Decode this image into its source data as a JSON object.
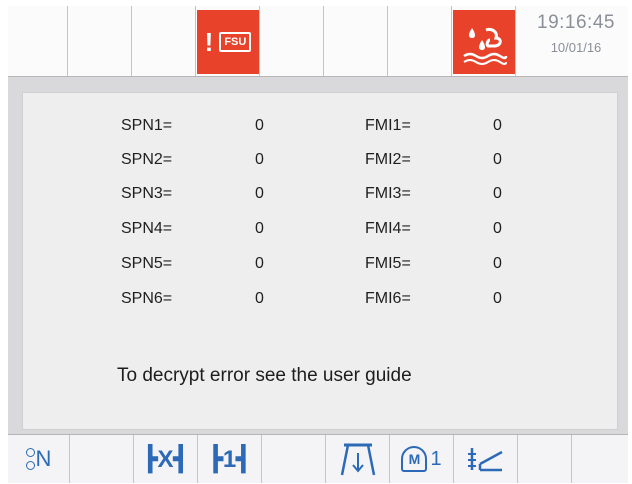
{
  "topbar": {
    "alarm_fsu": {
      "mark": "!",
      "label": "FSU",
      "icon": "fsu-alarm-icon"
    },
    "alarm_water": {
      "icon": "water-in-fuel-icon"
    },
    "clock": {
      "time": "19:16:45",
      "date": "10/01/16"
    }
  },
  "colors": {
    "alarm": "#e8432a",
    "bottom_icon": "#2c6ab8",
    "clock": "#8a8f98"
  },
  "codes": {
    "spn": [
      {
        "label": "SPN1=",
        "value": "0"
      },
      {
        "label": "SPN2=",
        "value": "0"
      },
      {
        "label": "SPN3=",
        "value": "0"
      },
      {
        "label": "SPN4=",
        "value": "0"
      },
      {
        "label": "SPN5=",
        "value": "0"
      },
      {
        "label": "SPN6=",
        "value": "0"
      }
    ],
    "fmi": [
      {
        "label": "FMI1=",
        "value": "0"
      },
      {
        "label": "FMI2=",
        "value": "0"
      },
      {
        "label": "FMI3=",
        "value": "0"
      },
      {
        "label": "FMI4=",
        "value": "0"
      },
      {
        "label": "FMI5=",
        "value": "0"
      },
      {
        "label": "FMI6=",
        "value": "0"
      }
    ]
  },
  "note": "To decrypt error see the user guide",
  "bottombar": {
    "neutral": "N",
    "mode_a": "X",
    "mode_b": "1",
    "implement_count": "1",
    "icons": [
      "neutral-gear-icon",
      "differential-lock-icon",
      "four-wheel-drive-icon",
      "implement-lift-icon",
      "engine-memory-icon",
      "hydraulic-flow-icon"
    ]
  }
}
